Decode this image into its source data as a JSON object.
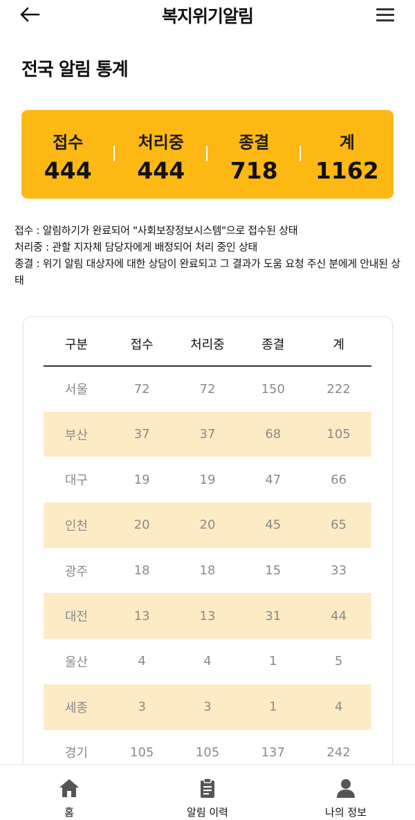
{
  "header": {
    "back_icon": "arrow-left-icon",
    "title": "복지위기알림",
    "menu_icon": "hamburger-menu-icon"
  },
  "page": {
    "title": "전국 알림 통계"
  },
  "summary": [
    {
      "label": "접수",
      "value": "444"
    },
    {
      "label": "처리중",
      "value": "444"
    },
    {
      "label": "종결",
      "value": "718"
    },
    {
      "label": "계",
      "value": "1162"
    }
  ],
  "notes": [
    "접수 : 알림하기가 완료되어 \"사회보장정보시스템\"으로 접수된 상태",
    "처리중 : 관할 지자체 담당자에게 배정되어 처리 중인 상태",
    "종결 : 위기 알림 대상자에 대한 상담이 완료되고 그 결과가 도움 요청 주신 분에게 안내된 상태"
  ],
  "table": {
    "headers": [
      "구분",
      "접수",
      "처리중",
      "종결",
      "계"
    ],
    "rows": [
      [
        "서울",
        "72",
        "72",
        "150",
        "222"
      ],
      [
        "부산",
        "37",
        "37",
        "68",
        "105"
      ],
      [
        "대구",
        "19",
        "19",
        "47",
        "66"
      ],
      [
        "인천",
        "20",
        "20",
        "45",
        "65"
      ],
      [
        "광주",
        "18",
        "18",
        "15",
        "33"
      ],
      [
        "대전",
        "13",
        "13",
        "31",
        "44"
      ],
      [
        "울산",
        "4",
        "4",
        "1",
        "5"
      ],
      [
        "세종",
        "3",
        "3",
        "1",
        "4"
      ],
      [
        "경기",
        "105",
        "105",
        "137",
        "242"
      ]
    ]
  },
  "bottom_nav": [
    {
      "label": "홈",
      "icon": "home-icon"
    },
    {
      "label": "알림 이력",
      "icon": "clipboard-icon"
    },
    {
      "label": "나의 정보",
      "icon": "user-icon"
    }
  ],
  "colors": {
    "accent": "#FDB813",
    "row_highlight": "#FDEBC6",
    "muted_text": "#8a8a8a"
  }
}
